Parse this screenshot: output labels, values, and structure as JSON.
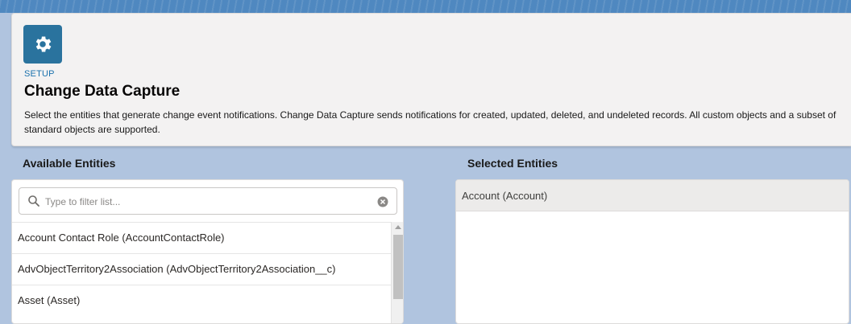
{
  "header": {
    "icon": "gear-icon",
    "breadcrumb": "SETUP",
    "title": "Change Data Capture",
    "description": "Select the entities that generate change event notifications. Change Data Capture sends notifications for created, updated, deleted, and undeleted records. All custom objects and a subset of standard objects are supported."
  },
  "available": {
    "title": "Available Entities",
    "filter": {
      "placeholder": "Type to filter list...",
      "value": ""
    },
    "items": [
      {
        "label": "Account Contact Role (AccountContactRole)"
      },
      {
        "label": "AdvObjectTerritory2Association (AdvObjectTerritory2Association__c)"
      },
      {
        "label": "Asset (Asset)"
      }
    ]
  },
  "selected": {
    "title": "Selected Entities",
    "items": [
      {
        "label": "Account (Account)"
      }
    ]
  },
  "colors": {
    "page_background": "#b0c4df",
    "top_band": "#4f88c0",
    "setup_icon_bg": "#2a739e",
    "breadcrumb_text": "#1b72ad",
    "selected_row_bg": "#ecebea"
  }
}
